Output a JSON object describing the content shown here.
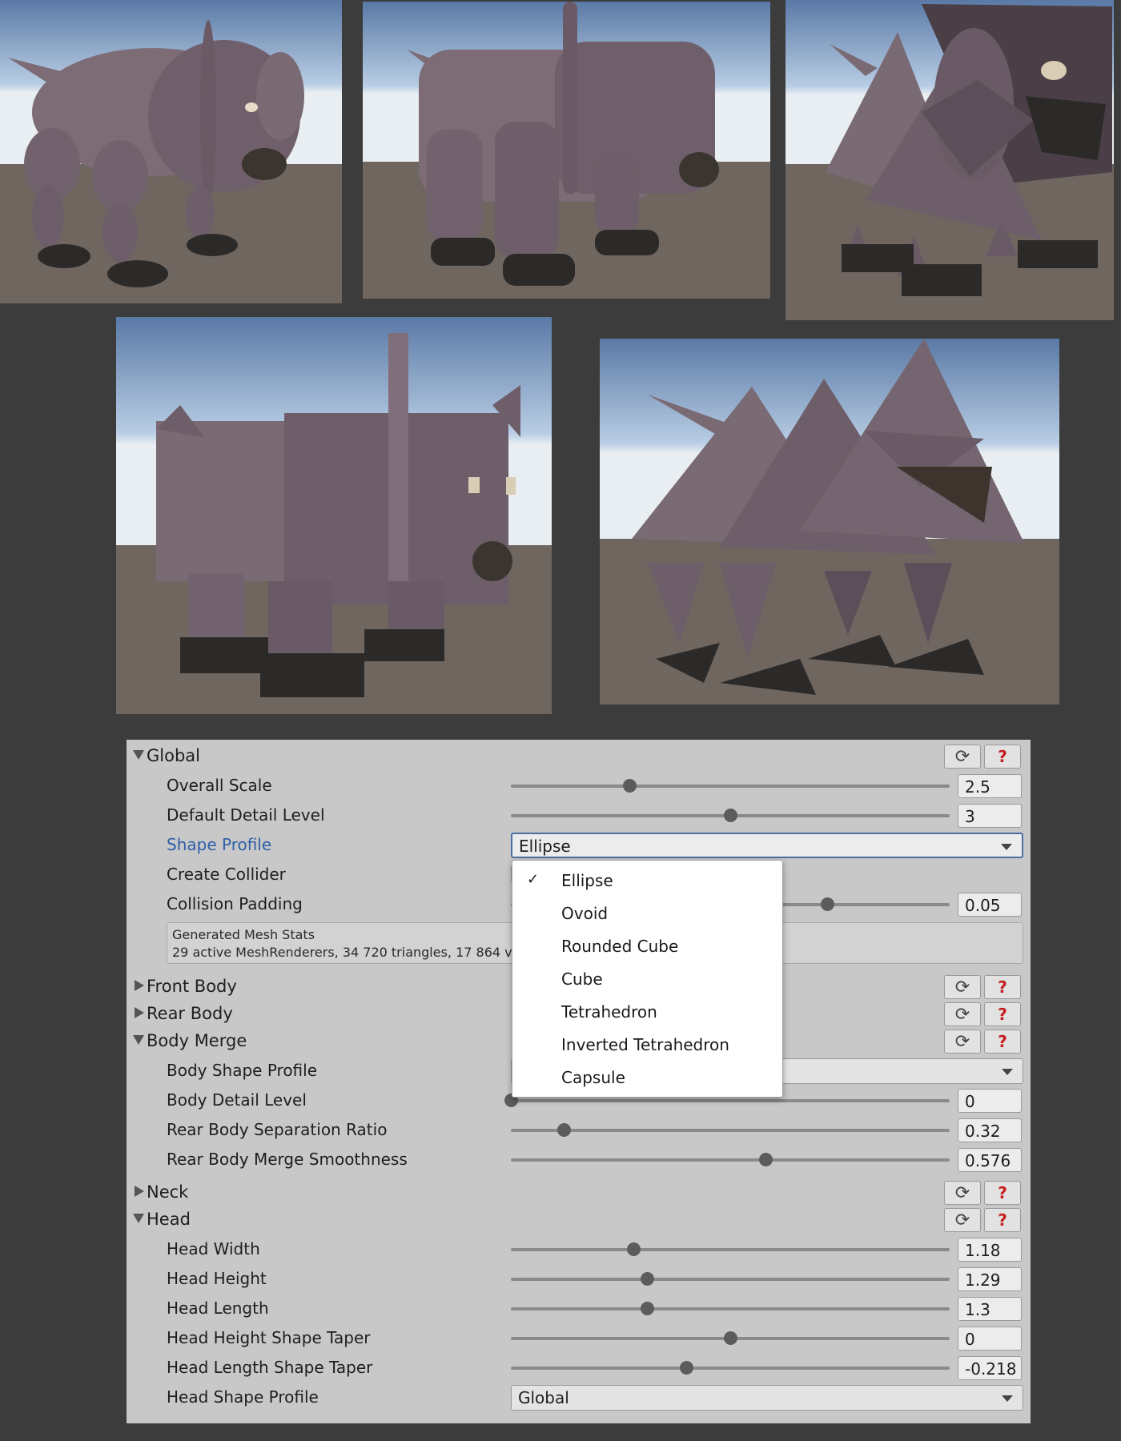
{
  "inspector": {
    "global": {
      "label": "Global",
      "overall_scale": {
        "label": "Overall Scale",
        "value": "2.5",
        "level": 0.27
      },
      "default_detail_level": {
        "label": "Default Detail Level",
        "value": "3",
        "level": 0.5
      },
      "shape_profile": {
        "label": "Shape Profile",
        "value": "Ellipse"
      },
      "create_collider": {
        "label": "Create Collider"
      },
      "collision_padding": {
        "label": "Collision Padding",
        "value": "0.05",
        "level": 0.72
      },
      "stats": {
        "title": "Generated Mesh Stats",
        "line": "29 active MeshRenderers, 34 720 triangles, 17 864 ve"
      }
    },
    "front_body": {
      "label": "Front Body"
    },
    "rear_body": {
      "label": "Rear Body"
    },
    "body_merge": {
      "label": "Body Merge",
      "body_shape_profile": {
        "label": "Body Shape Profile"
      },
      "body_detail_level": {
        "label": "Body Detail Level",
        "value": "0",
        "level": 0.0
      },
      "rear_body_separation_ratio": {
        "label": "Rear Body Separation Ratio",
        "value": "0.32",
        "level": 0.12
      },
      "rear_body_merge_smoothness": {
        "label": "Rear Body Merge Smoothness",
        "value": "0.576",
        "level": 0.58
      }
    },
    "neck": {
      "label": "Neck"
    },
    "head": {
      "label": "Head",
      "head_width": {
        "label": "Head Width",
        "value": "1.18",
        "level": 0.28
      },
      "head_height": {
        "label": "Head Height",
        "value": "1.29",
        "level": 0.31
      },
      "head_length": {
        "label": "Head Length",
        "value": "1.3",
        "level": 0.31
      },
      "head_height_shape_taper": {
        "label": "Head Height Shape Taper",
        "value": "0",
        "level": 0.5
      },
      "head_length_shape_taper": {
        "label": "Head Length Shape Taper",
        "value": "-0.218",
        "level": 0.4
      },
      "head_shape_profile": {
        "label": "Head Shape Profile",
        "value": "Global"
      }
    },
    "help_glyph": "?",
    "reset_glyph": "⟳"
  },
  "shape_menu": {
    "selected_mark": "✓",
    "items": [
      "Ellipse",
      "Ovoid",
      "Rounded Cube",
      "Cube",
      "Tetrahedron",
      "Inverted Tetrahedron",
      "Capsule"
    ],
    "selected_index": 0
  },
  "colors": {
    "background": "#3c3c3c",
    "inspector": "#c8c8c8",
    "creature": "#7a6a74",
    "feet": "#2e2c2a",
    "help": "#c41e1e",
    "active_label": "#2d5fa8"
  }
}
